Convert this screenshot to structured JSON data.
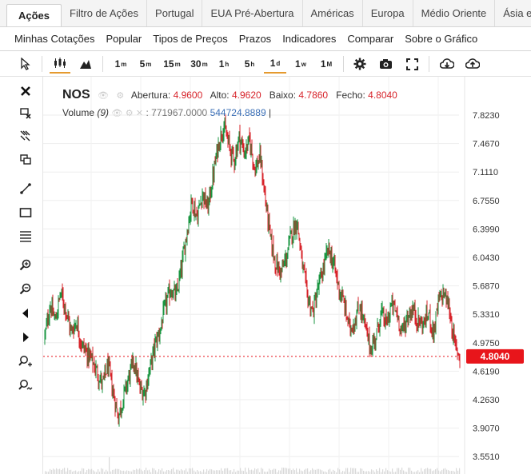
{
  "tabs": [
    "Ações",
    "Filtro de Ações",
    "Portugal",
    "EUA Pré-Abertura",
    "Américas",
    "Europa",
    "Médio Oriente",
    "Ásia e Oceania"
  ],
  "menu": [
    "Minhas Cotações",
    "Popular",
    "Tipos de Preços",
    "Prazos",
    "Indicadores",
    "Comparar",
    "Sobre o Gráfico"
  ],
  "toolbar": {
    "intervals": [
      {
        "label": "1",
        "sup": "m"
      },
      {
        "label": "5",
        "sup": "m"
      },
      {
        "label": "15",
        "sup": "m"
      },
      {
        "label": "30",
        "sup": "m"
      },
      {
        "label": "1",
        "sup": "h"
      },
      {
        "label": "5",
        "sup": "h"
      },
      {
        "label": "1",
        "sup": "d"
      },
      {
        "label": "1",
        "sup": "w"
      },
      {
        "label": "1",
        "sup": "M"
      }
    ],
    "active_interval": "1d"
  },
  "legend": {
    "symbol": "NOS",
    "open_label": "Abertura:",
    "open": "4.9600",
    "high_label": "Alto:",
    "high": "4.9620",
    "low_label": "Baixo:",
    "low": "4.7860",
    "close_label": "Fecho:",
    "close": "4.8040",
    "volume_label": "Volume",
    "volume_period": "(9)",
    "volume_value": ": 771967.0000",
    "volume_ma": "544724.8889",
    "volume_tail": "|"
  },
  "colors": {
    "up": "#1a9641",
    "down": "#d7232a",
    "price_tag": "#e8151b",
    "accent": "#e59a2f"
  },
  "chart_data": {
    "type": "candlestick",
    "ylim": [
      3.5,
      8.0
    ],
    "y_ticks": [
      "7.8230",
      "7.4670",
      "7.1110",
      "6.7550",
      "6.3990",
      "6.0430",
      "5.6870",
      "5.3310",
      "4.9750",
      "4.6190",
      "4.2630",
      "3.9070",
      "3.5510"
    ],
    "last_price": "4.8040",
    "close_path": [
      5.05,
      5.45,
      5.25,
      5.6,
      5.4,
      5.1,
      5.25,
      4.95,
      4.85,
      4.75,
      4.6,
      4.45,
      4.7,
      4.35,
      4.05,
      4.3,
      4.55,
      4.75,
      4.4,
      4.35,
      4.65,
      4.95,
      5.15,
      5.45,
      5.65,
      5.55,
      5.9,
      6.35,
      6.75,
      6.55,
      6.85,
      6.65,
      7.05,
      7.45,
      7.7,
      7.45,
      7.25,
      7.55,
      7.35,
      7.5,
      7.15,
      7.3,
      6.75,
      6.25,
      5.95,
      5.85,
      6.05,
      6.35,
      6.5,
      5.95,
      5.55,
      5.35,
      5.65,
      5.9,
      6.15,
      5.95,
      5.65,
      5.45,
      5.15,
      5.25,
      5.45,
      5.15,
      4.9,
      5.05,
      5.35,
      5.2,
      5.45,
      5.35,
      5.1,
      5.3,
      5.4,
      5.25,
      5.2,
      5.35,
      5.1,
      5.5,
      5.6,
      5.4,
      4.95,
      4.8
    ]
  }
}
